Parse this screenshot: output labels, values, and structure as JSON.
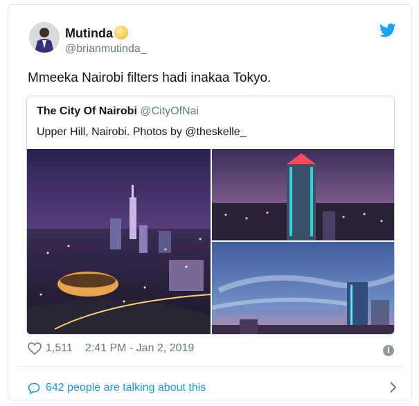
{
  "author": {
    "display_name": "Mutinda",
    "handle": "@brianmutinda_",
    "name_emoji": "full-moon-face-emoji"
  },
  "tweet": {
    "text": "Mmeeka Nairobi filters hadi inakaa Tokyo."
  },
  "quoted_tweet": {
    "display_name": "The City Of Nairobi",
    "handle": "@CityOfNai",
    "text": "Upper Hill, Nairobi. Photos by @theskelle_",
    "photo_count": 3
  },
  "footer": {
    "likes": "1,511",
    "timestamp": "2:41 PM - Jan 2, 2019",
    "info_icon": "i",
    "conversation_text": "642 people are talking about this"
  },
  "colors": {
    "link_blue": "#1b95e0",
    "twitter_blue": "#1da1f2",
    "text_dark": "#14171a",
    "text_gray": "#657786",
    "border": "#e1e8ed"
  },
  "icons": [
    "twitter-bird-icon",
    "heart-icon",
    "info-icon",
    "speech-bubble-icon",
    "chevron-right-icon"
  ]
}
